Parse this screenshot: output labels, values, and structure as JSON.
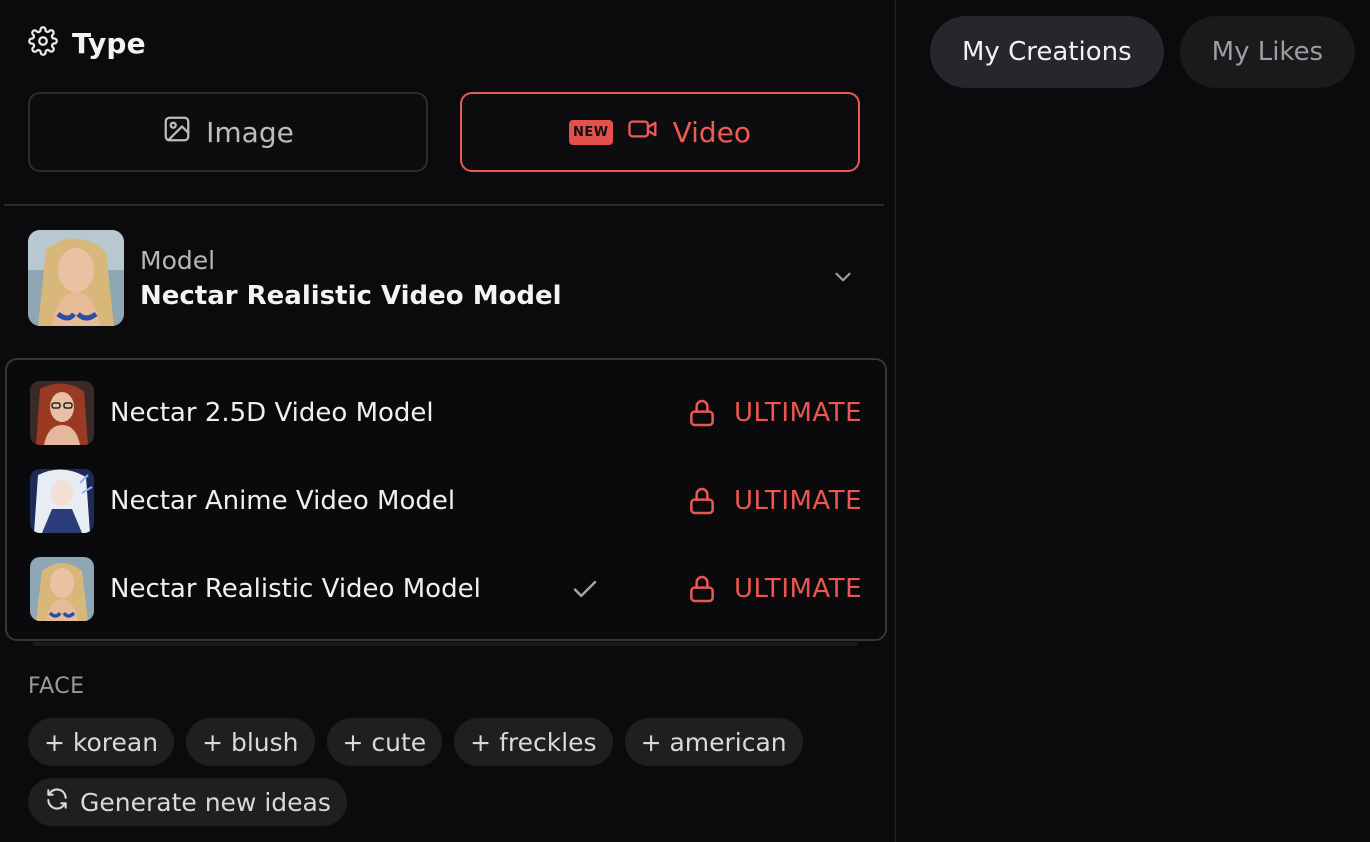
{
  "type_section": {
    "title": "Type",
    "icon": "gear-icon",
    "buttons": [
      {
        "label": "Image",
        "icon": "image-icon",
        "selected": false
      },
      {
        "label": "Video",
        "icon": "video-camera-icon",
        "badge": "NEW",
        "selected": true
      }
    ]
  },
  "model_select": {
    "label": "Model",
    "value": "Nectar Realistic Video Model"
  },
  "model_options": [
    {
      "label": "Nectar 2.5D Video Model",
      "tier": "ULTIMATE",
      "selected": false
    },
    {
      "label": "Nectar Anime Video Model",
      "tier": "ULTIMATE",
      "selected": false
    },
    {
      "label": "Nectar Realistic Video Model",
      "tier": "ULTIMATE",
      "selected": true
    }
  ],
  "face_section": {
    "label": "FACE",
    "chips": [
      "+ korean",
      "+ blush",
      "+ cute",
      "+ freckles",
      "+ american"
    ],
    "generate_label": "Generate new ideas"
  },
  "right_tabs": [
    {
      "label": "My Creations",
      "active": true
    },
    {
      "label": "My Likes",
      "active": false
    }
  ],
  "colors": {
    "accent": "#e65a55",
    "background": "#0b0b0d",
    "chip_bg": "#1f1f22"
  }
}
